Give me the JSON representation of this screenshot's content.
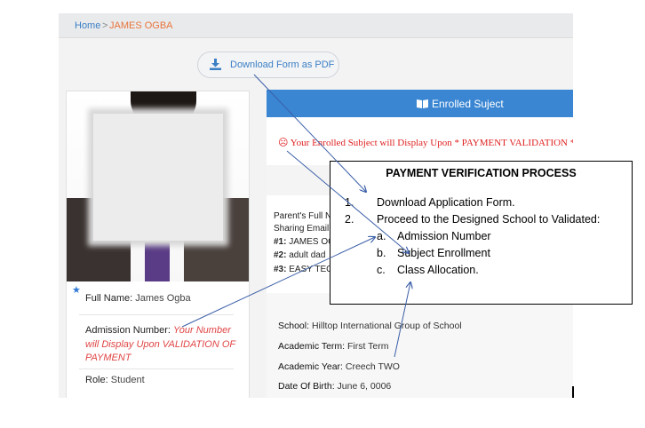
{
  "breadcrumb": {
    "home": "Home",
    "separator": ">",
    "current": "JAMES OGBA"
  },
  "download": {
    "label": "Download Form as PDF",
    "icon": "download-icon"
  },
  "profile": {
    "full_name_label": "Full Name:",
    "full_name": "James Ogba",
    "admission_label": "Admission Number:",
    "admission_note": "Your Number will Display Upon VALIDATION OF PAYMENT",
    "role_label": "Role:",
    "role": "Student"
  },
  "enrolled": {
    "header": "Enrolled Suject",
    "notice": "☹ Your Enrolled Subject will Display Upon * PAYMENT VALIDATION *"
  },
  "parents": {
    "line1": "Parent's Full N",
    "line2": "Sharing Email",
    "items": [
      {
        "num": "#1:",
        "text": "JAMES OG"
      },
      {
        "num": "#2:",
        "text": "adult dad"
      },
      {
        "num": "#3:",
        "text": "EASY TEC"
      }
    ]
  },
  "school_info": {
    "school_label": "School:",
    "school": "Hilltop International Group of School",
    "term_label": "Academic Term:",
    "term": "First Term",
    "year_label": "Academic Year:",
    "year": "Creech TWO",
    "dob_label": "Date Of Birth:",
    "dob": "June 6, 0006"
  },
  "callout": {
    "title": "PAYMENT VERIFICATION PROCESS",
    "steps": [
      {
        "num": "1.",
        "text": "Download Application Form."
      },
      {
        "num": "2.",
        "text": "Proceed to the Designed School to Validated:"
      }
    ],
    "substeps": [
      {
        "letter": "a.",
        "text": "Admission Number"
      },
      {
        "letter": "b.",
        "text": "Subject Enrollment"
      },
      {
        "letter": "c.",
        "text": "Class Allocation."
      }
    ]
  },
  "colors": {
    "accent": "#3a86d3",
    "link": "#3b7fc4",
    "warning": "#e02020",
    "breadcrumb_current": "#e8743b"
  }
}
